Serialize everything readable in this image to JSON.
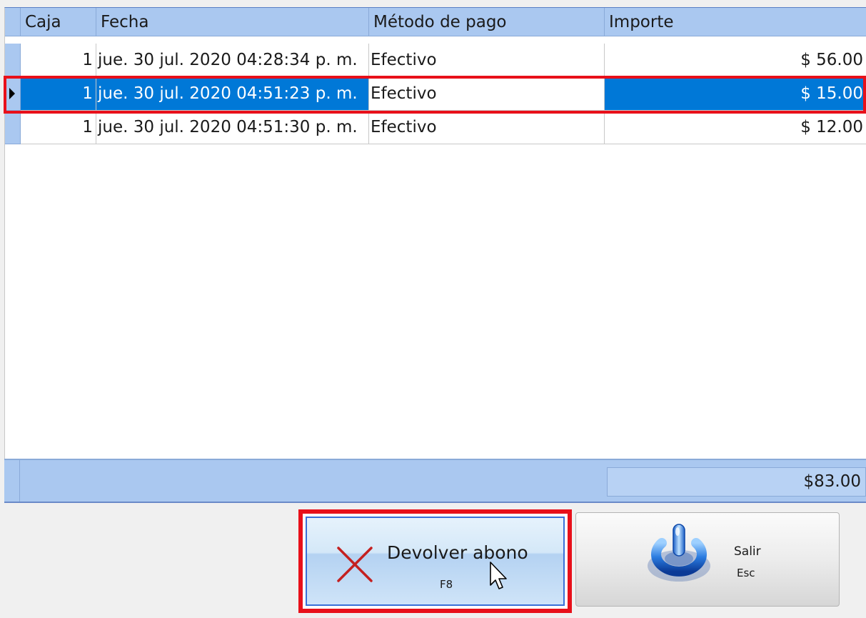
{
  "grid": {
    "columns": [
      "Caja",
      "Fecha",
      "Método de pago",
      "Importe"
    ],
    "rows": [
      {
        "caja": "1",
        "fecha": "jue. 30 jul. 2020 04:28:34 p. m.",
        "metodo": "Efectivo",
        "importe": "$ 56.00"
      },
      {
        "caja": "1",
        "fecha": "jue. 30 jul. 2020 04:51:23 p. m.",
        "metodo": "Efectivo",
        "importe": "$ 15.00"
      },
      {
        "caja": "1",
        "fecha": "jue. 30 jul. 2020 04:51:30 p. m.",
        "metodo": "Efectivo",
        "importe": "$ 12.00"
      }
    ],
    "selected_row": 1,
    "total": "$83.00"
  },
  "buttons": {
    "refund_label": "Devolver abono",
    "refund_key": "F8",
    "exit_label": "Salir",
    "exit_key": "Esc"
  },
  "colors": {
    "header_blue": "#aac8f0",
    "selection_blue": "#0078d7",
    "highlight_red": "#e8101a"
  },
  "icons": {
    "refund": "close-x-icon",
    "exit": "power-icon",
    "cursor": "mouse-pointer-icon"
  }
}
